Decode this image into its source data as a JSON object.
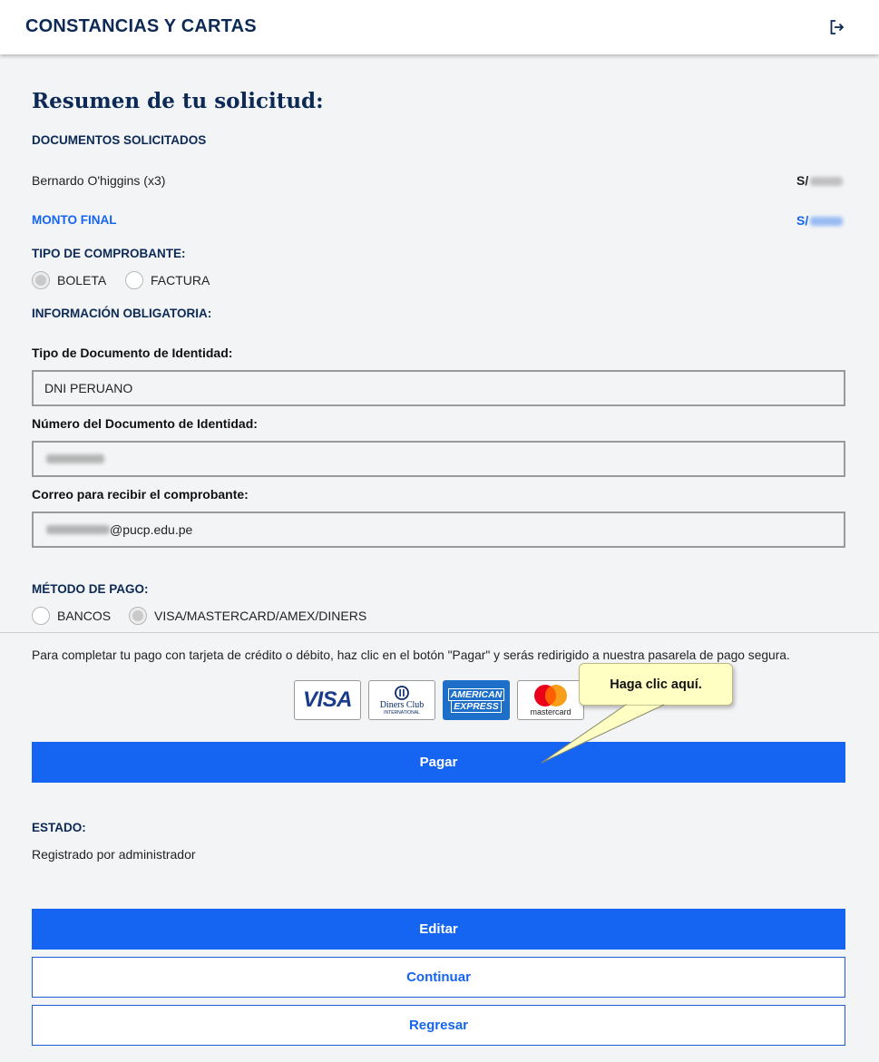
{
  "header": {
    "title": "CONSTANCIAS Y CARTAS",
    "logout_icon": "logout-icon"
  },
  "summary": {
    "title": "Resumen de tu solicitud:",
    "documents_heading": "DOCUMENTOS SOLICITADOS",
    "document_item": "Bernardo O'higgins (x3)",
    "document_currency": "S/",
    "final_amount_label": "MONTO FINAL",
    "final_amount_currency": "S/"
  },
  "receipt_type": {
    "heading": "TIPO DE COMPROBANTE:",
    "options": [
      {
        "label": "BOLETA",
        "selected": true
      },
      {
        "label": "FACTURA",
        "selected": false
      }
    ]
  },
  "mandatory": {
    "heading": "INFORMACIÓN OBLIGATORIA:",
    "id_type_label": "Tipo de Documento de Identidad:",
    "id_type_value": "DNI PERUANO",
    "id_number_label": "Número del Documento de Identidad:",
    "email_label": "Correo para recibir el comprobante:",
    "email_suffix": "@pucp.edu.pe"
  },
  "payment": {
    "heading": "MÉTODO DE PAGO:",
    "options": [
      {
        "label": "BANCOS",
        "selected": false
      },
      {
        "label": "VISA/MASTERCARD/AMEX/DINERS",
        "selected": true
      }
    ],
    "instruction": "Para completar tu pago con tarjeta de crédito o débito, haz clic en el botón \"Pagar\" y serás redirigido a nuestra pasarela de pago segura.",
    "cards": {
      "visa": "VISA",
      "diners_line1": "Diners Club",
      "diners_line2": "INTERNATIONAL",
      "amex_line1": "AMERICAN",
      "amex_line2": "EXPRESS",
      "mastercard": "mastercard"
    },
    "pay_button": "Pagar",
    "tooltip": "Haga clic aquí."
  },
  "status": {
    "label": "ESTADO:",
    "value": "Registrado por administrador"
  },
  "actions": {
    "edit": "Editar",
    "continue": "Continuar",
    "back": "Regresar"
  },
  "colors": {
    "primary": "#1665f2",
    "navy": "#0c2a55",
    "background": "#f3f4f6",
    "callout": "#ffffc4"
  }
}
